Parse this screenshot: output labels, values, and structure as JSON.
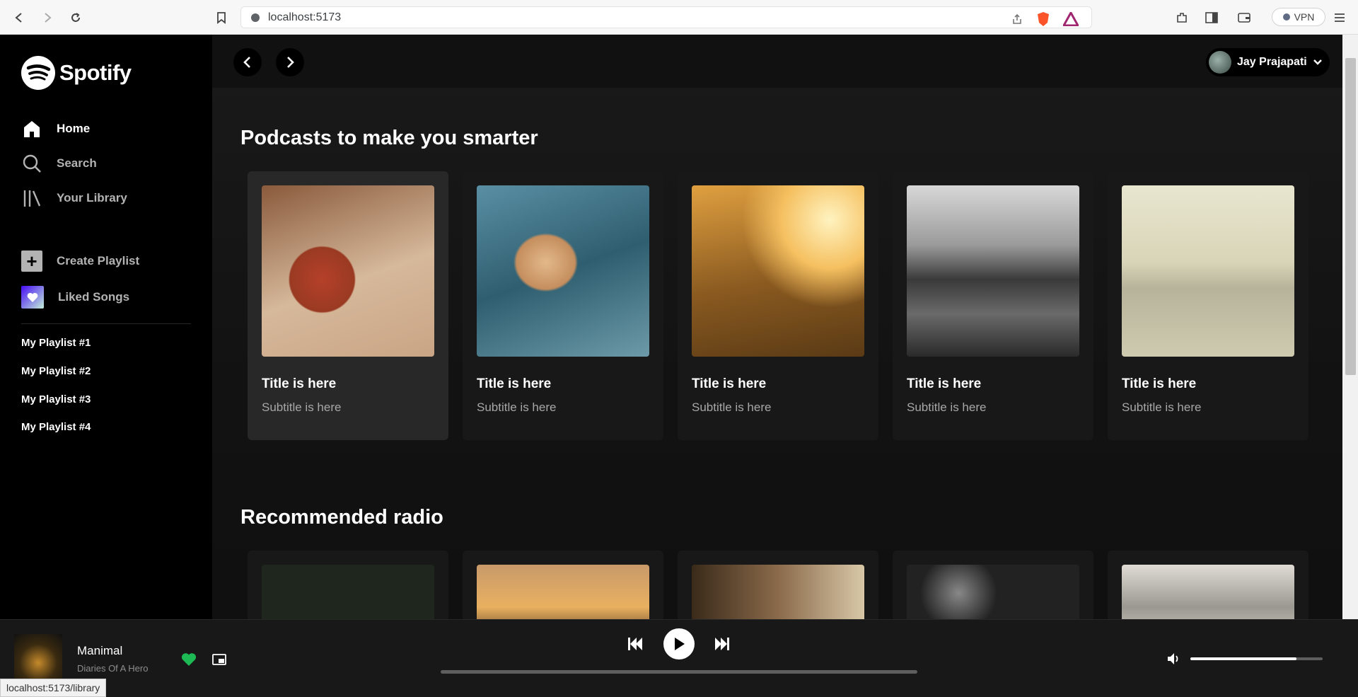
{
  "browser": {
    "url": "localhost:5173",
    "vpn_label": "VPN",
    "status_url": "localhost:5173/library"
  },
  "sidebar": {
    "logo_text": "Spotify",
    "nav": [
      {
        "label": "Home",
        "icon": "home-icon"
      },
      {
        "label": "Search",
        "icon": "search-icon"
      },
      {
        "label": "Your Library",
        "icon": "library-icon"
      }
    ],
    "create_playlist": "Create Playlist",
    "liked_songs": "Liked Songs",
    "playlists": [
      "My Playlist #1",
      "My Playlist #2",
      "My Playlist #3",
      "My Playlist #4"
    ]
  },
  "header": {
    "user_name": "Jay Prajapati"
  },
  "sections": [
    {
      "title": "Podcasts to make you smarter",
      "cards": [
        {
          "title": "Title is here",
          "subtitle": "Subtitle is here"
        },
        {
          "title": "Title is here",
          "subtitle": "Subtitle is here"
        },
        {
          "title": "Title is here",
          "subtitle": "Subtitle is here"
        },
        {
          "title": "Title is here",
          "subtitle": "Subtitle is here"
        },
        {
          "title": "Title is here",
          "subtitle": "Subtitle is here"
        }
      ]
    },
    {
      "title": "Recommended radio"
    }
  ],
  "player": {
    "song": "Manimal",
    "artist": "Diaries Of A Hero",
    "liked": true,
    "progress": 0,
    "volume": 0.8
  },
  "colors": {
    "accent": "#1db954",
    "background": "#121212",
    "sidebar": "#000000"
  }
}
